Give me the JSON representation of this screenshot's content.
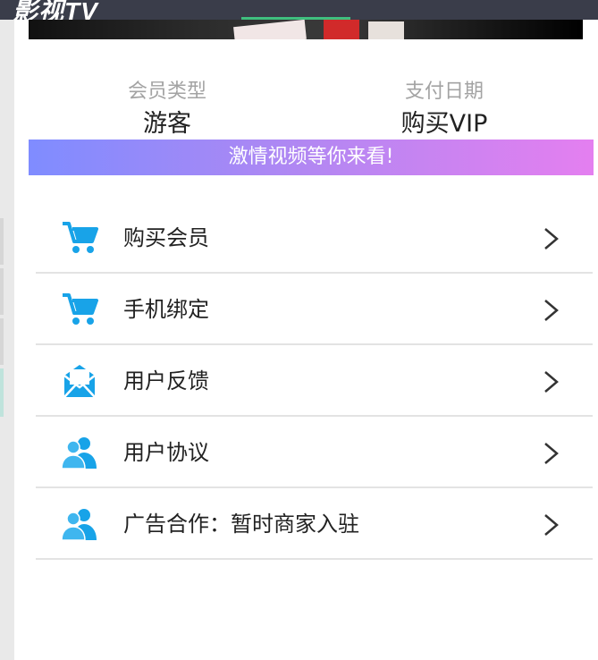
{
  "header": {
    "logo_text": "影视TV",
    "accent_color": "#3fbf7f"
  },
  "info": {
    "member_type": {
      "label": "会员类型",
      "value": "游客"
    },
    "pay_date": {
      "label": "支付日期",
      "value": "购买VIP"
    }
  },
  "promo": {
    "text": "激情视频等你来看!"
  },
  "menu": {
    "items": [
      {
        "icon": "cart-icon",
        "label": "购买会员"
      },
      {
        "icon": "cart-icon",
        "label": "手机绑定"
      },
      {
        "icon": "mail-icon",
        "label": "用户反馈"
      },
      {
        "icon": "users-icon",
        "label": "用户协议"
      },
      {
        "icon": "users-icon",
        "label": "广告合作：暂时商家入驻"
      }
    ]
  },
  "colors": {
    "icon_blue": "#18a3e8",
    "promo_start": "#7f8cff",
    "promo_end": "#e47ff0"
  }
}
